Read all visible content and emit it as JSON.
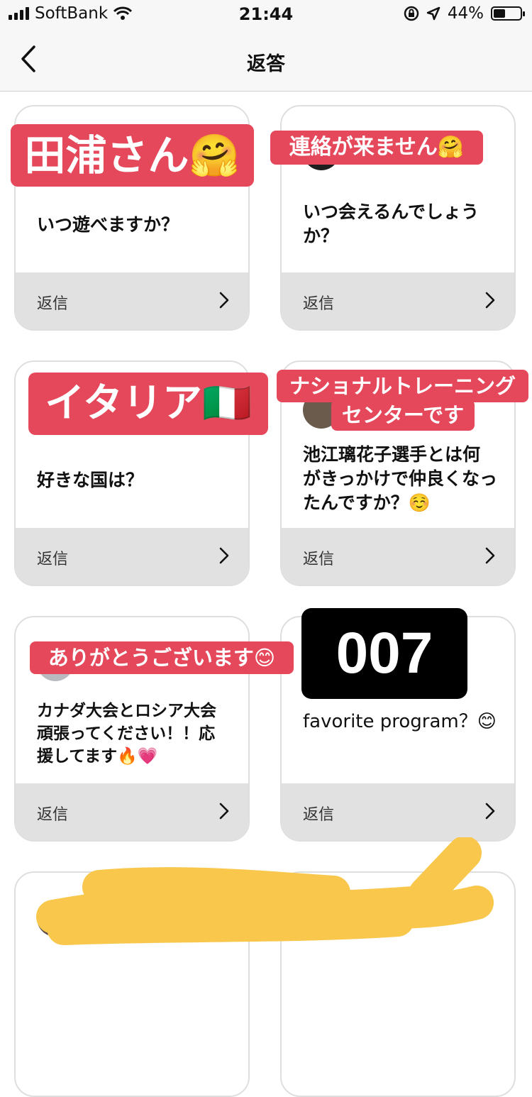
{
  "status_bar": {
    "carrier": "SoftBank",
    "time": "21:44",
    "battery": "44%",
    "battery_level": 0.44
  },
  "nav": {
    "title": "返答"
  },
  "cards": [
    {
      "question": "いつ遊べますか？",
      "answer": "田浦さん🤗",
      "reply": "返信"
    },
    {
      "question": "いつ会えるんでしょうか？",
      "answer": "連絡が来ません🤗",
      "reply": "返信"
    },
    {
      "question": "好きな国は？",
      "answer": "イタリア🇮🇹",
      "reply": "返信"
    },
    {
      "question": "池江璃花子選手とは何がきっかけで仲良くなったんですか？☺️",
      "answer_line1": "ナショナルトレーニング",
      "answer_line2": "センターです",
      "reply": "返信"
    },
    {
      "question": "カナダ大会とロシア大会頑張ってください！！応援してます🔥💗",
      "answer": "ありがとうございます😊",
      "reply": "返信"
    },
    {
      "question": "favorite program？😊",
      "answer": "007",
      "reply": "返信"
    }
  ],
  "colors": {
    "sticker": "#e5485a",
    "reply_bar": "#e1e1e1",
    "scribble": "#f8c74c"
  }
}
